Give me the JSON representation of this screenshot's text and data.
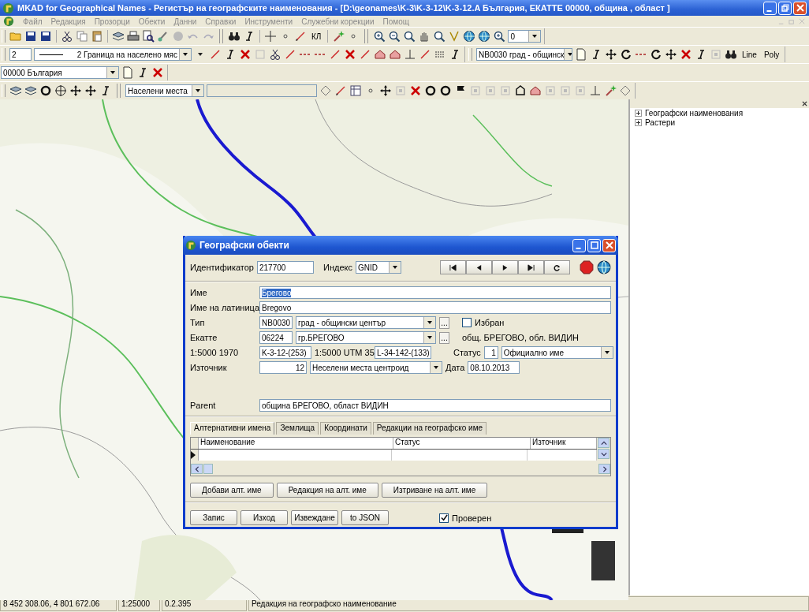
{
  "window": {
    "title": "MKAD for Geographical Names - Регистър на географските наименования - [D:\\geonames\\K-3\\K-3-12\\K-3-12.A България, ЕКАТТЕ 00000, община , област ]"
  },
  "menu": [
    "Файл",
    "Редакция",
    "Прозорци",
    "Обекти",
    "Данни",
    "Справки",
    "Инструменти",
    "Служебни корекции",
    "Помощ"
  ],
  "toolbar_main": {
    "label_button": "КЛ",
    "zoom_combo": "0"
  },
  "toolbar_line": {
    "width_value": "2",
    "style_combo": "2 Граница на населено мяс"
  },
  "toolbar_object": {
    "type_combo": "NB0030 град - общинск",
    "text_buttons": [
      "Line",
      "Poly"
    ]
  },
  "region_combo": "00000 България",
  "layer_toolbar": {
    "layer_combo": "Населени места"
  },
  "layers_panel": {
    "items": [
      {
        "label": "Географски наименования",
        "expanded": false
      },
      {
        "label": "Растери",
        "expanded": false
      }
    ]
  },
  "dialog": {
    "title": "Географски обекти",
    "id_label": "Идентификатор",
    "id_value": "217700",
    "index_label": "Индекс",
    "index_value": "GNID",
    "name": {
      "label": "Име",
      "value": "Брегово",
      "highlighted": true
    },
    "latin": {
      "label": "Име на латиница",
      "value": "Bregovo"
    },
    "type": {
      "label": "Тип",
      "code": "NB0030",
      "value": "град - общински център",
      "browse_button": "...",
      "checkbox": {
        "label": "Избран",
        "checked": false
      }
    },
    "ekatte": {
      "label": "Екатте",
      "code": "06224",
      "value": "гр.БРЕГОВО",
      "browse_button": "...",
      "note": "общ. БРЕГОВО, обл. ВИДИН"
    },
    "sheets": {
      "label_1970": "1:5000 1970",
      "value_1970": "K-3-12-(253)",
      "label_utm": "1:5000 UTM 35",
      "value_utm": "L-34-142-(133)"
    },
    "status": {
      "label": "Статус",
      "code": "1",
      "value": "Официално име"
    },
    "source": {
      "label": "Източник",
      "code": "12",
      "value": "Неселени места центроид"
    },
    "date": {
      "label": "Дата",
      "value": "08.10.2013"
    },
    "parent": {
      "label": "Parent",
      "value": "община БРЕГОВО, област ВИДИН"
    },
    "tabs": [
      {
        "label": "Алтернативни имена",
        "selected": true
      },
      {
        "label": "Землища",
        "selected": false
      },
      {
        "label": "Координати",
        "selected": false
      },
      {
        "label": "Редакции на географско име",
        "selected": false
      }
    ],
    "grid": {
      "columns": [
        "Наименование",
        "Статус",
        "Източник"
      ]
    },
    "grid_buttons": [
      "Добави алт. име",
      "Редакция на алт. име",
      "Изтриване на алт. име"
    ],
    "buttons": [
      "Запис",
      "Изход",
      "Извеждане",
      "to JSON"
    ],
    "verified": {
      "label": "Проверен",
      "checked": true
    }
  },
  "status_bar": [
    "8 452 308.06,  4 801 672.06",
    "1:25000",
    "0.2.395",
    "Редакция  на географско наименование"
  ]
}
